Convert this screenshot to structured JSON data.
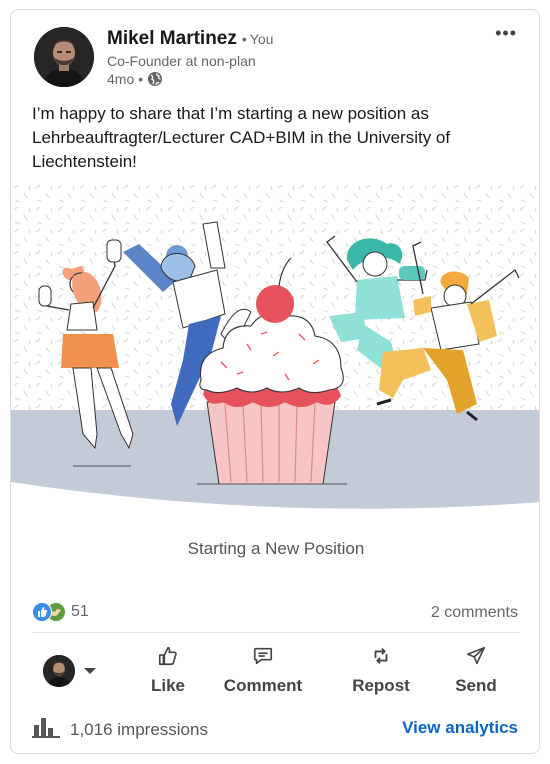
{
  "post": {
    "author": {
      "name": "Mikel Martinez",
      "you_label": "You",
      "headline": "Co-Founder at non-plan",
      "age": "4mo"
    },
    "text": "I’m happy to share that I’m starting a new position as Lehrbeauftragter/Lecturer CAD+BIM in the University of Liechtenstein!",
    "illustration_caption": "Starting a New Position",
    "more_label": "•••"
  },
  "social": {
    "reaction_count": "51",
    "reactions": [
      "like-icon",
      "support-icon"
    ],
    "comments": "2 comments"
  },
  "actions": [
    {
      "label": "Like",
      "icon": "like-icon"
    },
    {
      "label": "Comment",
      "icon": "comment-icon"
    },
    {
      "label": "Repost",
      "icon": "repost-icon"
    },
    {
      "label": "Send",
      "icon": "send-icon"
    }
  ],
  "footer": {
    "impressions": "1,016 impressions",
    "analytics_link": "View analytics"
  },
  "colors": {
    "brand_blue": "#0a66c2",
    "like_blue": "#378fe9",
    "support_green": "#5f9b41",
    "ground": "#c3cbd8",
    "cherry": "#e15a5a"
  }
}
